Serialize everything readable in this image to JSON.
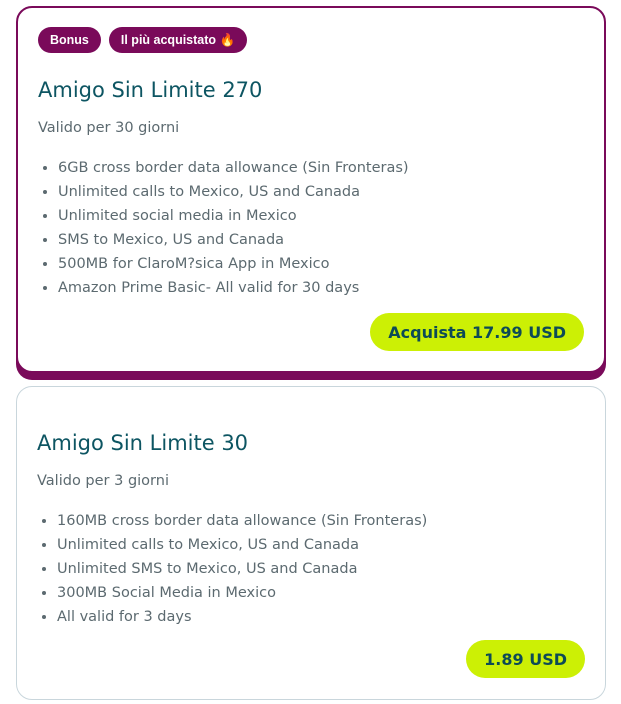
{
  "plans": [
    {
      "badges": [
        "Bonus",
        "Il più acquistato 🔥"
      ],
      "title": "Amigo Sin Limite 270",
      "validity": "Valido per 30 giorni",
      "features": [
        "6GB cross border data allowance (Sin Fronteras)",
        "Unlimited calls to Mexico, US and Canada",
        "Unlimited social media in Mexico",
        "SMS to Mexico, US and Canada",
        "500MB for ClaroM?sica App in Mexico",
        "Amazon Prime Basic- All valid for 30 days"
      ],
      "button_label": "Acquista 17.99 USD"
    },
    {
      "title": "Amigo Sin Limite 30",
      "validity": "Valido per 3 giorni",
      "features": [
        "160MB cross border data allowance (Sin Fronteras)",
        "Unlimited calls to Mexico, US and Canada",
        "Unlimited SMS to Mexico, US and Canada",
        "300MB Social Media in Mexico",
        "All valid for 3 days"
      ],
      "button_label": "1.89 USD"
    }
  ],
  "colors": {
    "highlight_border": "#7a0a5a",
    "badge_bg": "#7a0a5a",
    "title": "#0d5562",
    "body_text": "#5c6a70",
    "button_bg": "#ccf005",
    "card_border": "#c9d6dc"
  }
}
